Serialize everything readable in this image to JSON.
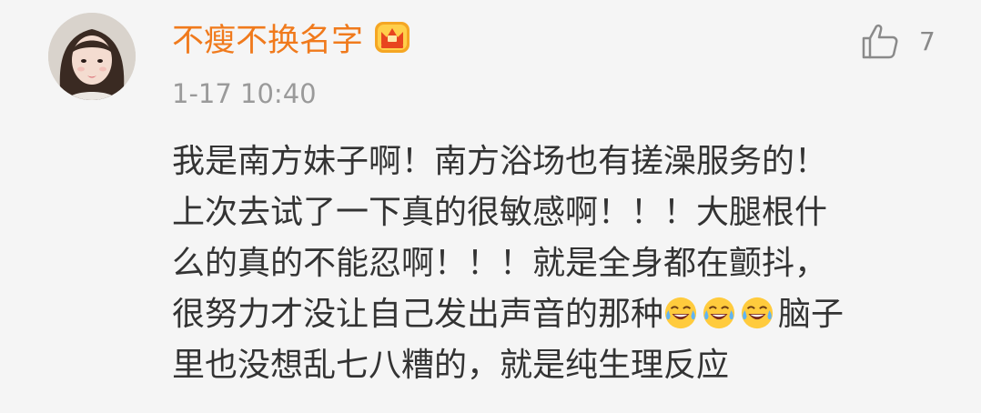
{
  "user": {
    "name": "不瘦不换名字",
    "badge_icon": "crown-badge-icon",
    "avatar_icon": "avatar-photo"
  },
  "meta": {
    "timestamp": "1-17 10:40"
  },
  "like": {
    "icon": "thumbs-up-icon",
    "count": "7"
  },
  "comment": {
    "lines": [
      "我是南方妹子啊！南方浴场也有搓澡服务的！",
      "上次去试了一下真的很敏感啊！！！大腿根什",
      "么的真的不能忍啊！！！就是全身都在颤抖，",
      "很努力才没让自己发出声音的那种",
      "里也没想乱七八糟的，就是纯生理反应"
    ],
    "line4_tail": "脑子",
    "emojis": [
      "laugh-cry-emoji",
      "laugh-cry-emoji",
      "laugh-cry-emoji"
    ]
  },
  "colors": {
    "background": "#f5f5f5",
    "username": "#f07a1c",
    "timestamp": "#9a9a9a",
    "text": "#333333",
    "badge": "#f5a623"
  }
}
